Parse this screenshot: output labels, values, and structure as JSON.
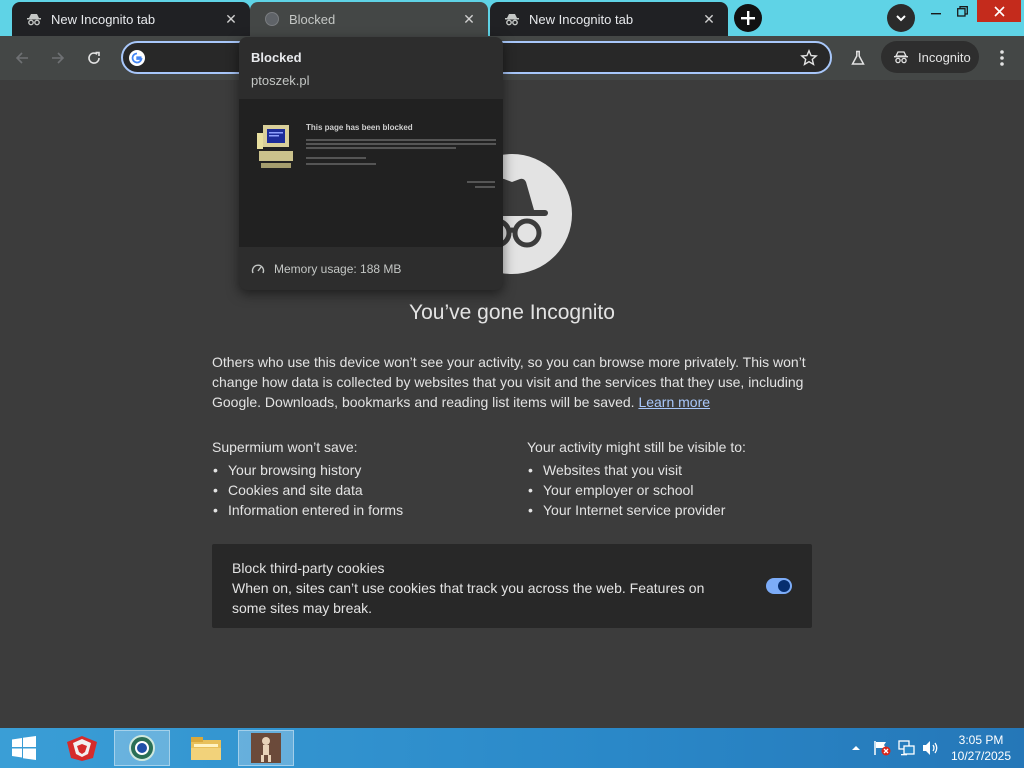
{
  "tabs": [
    {
      "title": "New Incognito tab",
      "state": "inactive"
    },
    {
      "title": "Blocked",
      "state": "active"
    },
    {
      "title": "New Incognito tab",
      "state": "inactive"
    }
  ],
  "toolbar": {
    "omnibox_value": "",
    "incognito_label": "Incognito"
  },
  "hover_card": {
    "title": "Blocked",
    "domain": "ptoszek.pl",
    "memory": "Memory usage: 188 MB",
    "preview": {
      "heading": "This page has been blocked"
    }
  },
  "content": {
    "headline": "You’ve gone Incognito",
    "intro": "Others who use this device won’t see your activity, so you can browse more privately. This won’t change how data is collected by websites that you visit and the services that they use, including Google. Downloads, bookmarks and reading list items will be saved.",
    "learn_more": "Learn more",
    "wont_save": {
      "heading": "Supermium won’t save:",
      "items": [
        "Your browsing history",
        "Cookies and site data",
        "Information entered in forms"
      ]
    },
    "might_be_visible": {
      "heading": "Your activity might still be visible to:",
      "items": [
        "Websites that you visit",
        "Your employer or school",
        "Your Internet service provider"
      ]
    },
    "cookies_card": {
      "title": "Block third-party cookies",
      "description": "When on, sites can’t use cookies that track you across the web. Features on some sites may break.",
      "enabled": true
    }
  },
  "taskbar": {
    "time": "3:05 PM",
    "date": "10/27/2025"
  },
  "colors": {
    "tabstrip": "#5fd3e6",
    "toolbar": "#444746",
    "content_bg": "#3c3c3c",
    "link": "#a8c7fa",
    "toggle": "#7cacf8",
    "close_button": "#c42b1c"
  }
}
